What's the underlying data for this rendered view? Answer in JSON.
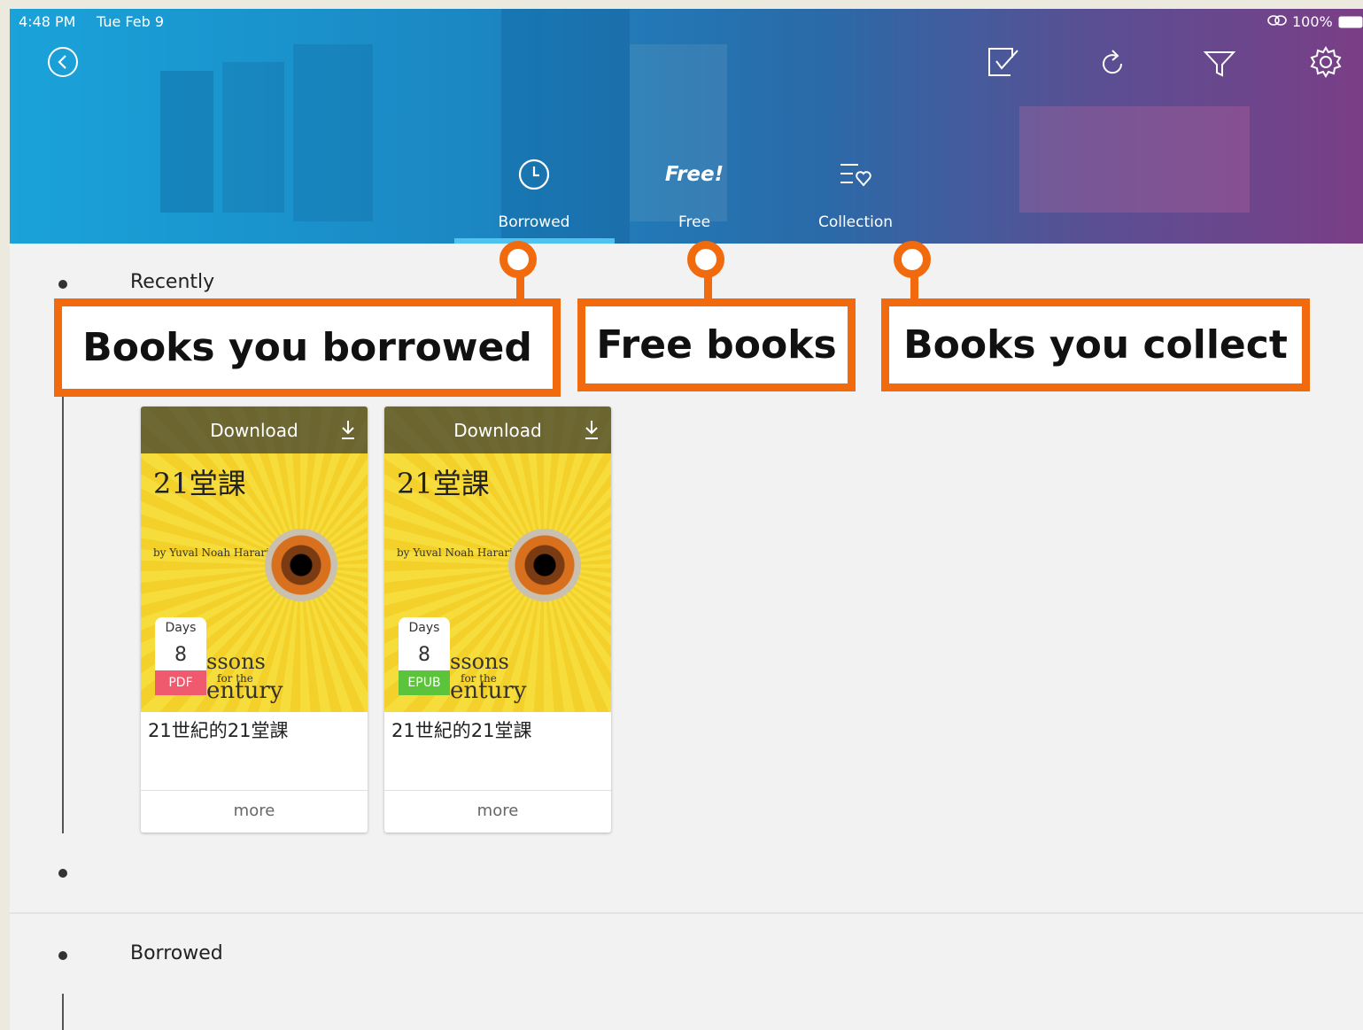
{
  "status_bar": {
    "time": "4:48 PM",
    "date": "Tue Feb 9",
    "battery": "100%"
  },
  "tabs": [
    {
      "label": "Borrowed",
      "active": true
    },
    {
      "label": "Free",
      "icon_text": "Free!"
    },
    {
      "label": "Collection"
    }
  ],
  "sections": [
    {
      "title": "Recently"
    },
    {
      "title": "Borrowed"
    }
  ],
  "callouts": {
    "borrowed": "Books you borrowed",
    "free": "Free books",
    "collection": "Books you collect"
  },
  "books": [
    {
      "download_label": "Download",
      "days_label": "Days",
      "days": "8",
      "format": "PDF",
      "format_color": "#f05a6e",
      "title": "21世紀的21堂課",
      "more_label": "more",
      "cover": {
        "title_cn": "21堂課",
        "author": "by Yuval Noah Harari",
        "lessons": "ssons",
        "for_the": "for the",
        "century": "entury"
      }
    },
    {
      "download_label": "Download",
      "days_label": "Days",
      "days": "8",
      "format": "EPUB",
      "format_color": "#5cc43a",
      "title": "21世紀的21堂課",
      "more_label": "more",
      "cover": {
        "title_cn": "21堂課",
        "author": "by Yuval Noah Harari",
        "lessons": "ssons",
        "for_the": "for the",
        "century": "entury"
      }
    }
  ],
  "colors": {
    "accent": "#f26a0e",
    "tab_underline": "#4ec3ef"
  },
  "icons": [
    "back-icon",
    "select-icon",
    "refresh-icon",
    "filter-icon",
    "settings-icon",
    "clock-icon",
    "collection-heart-icon",
    "download-icon",
    "link-icon",
    "battery-icon"
  ]
}
